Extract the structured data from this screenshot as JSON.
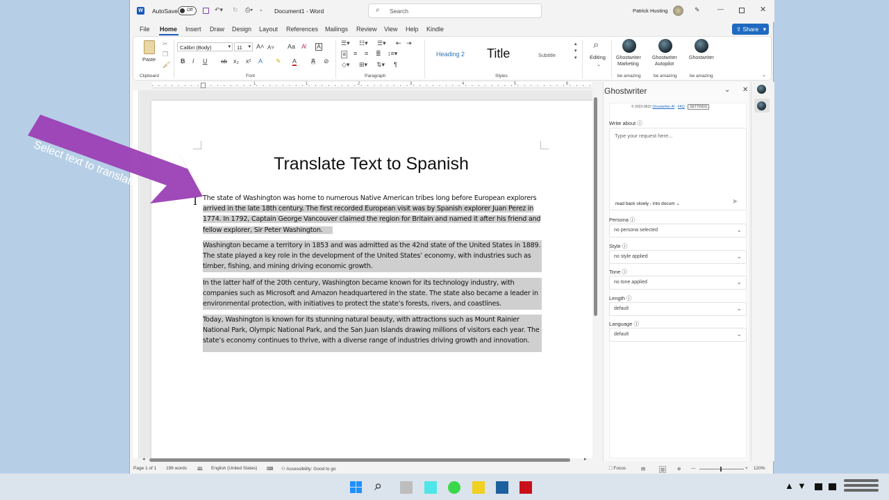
{
  "app": {
    "autosave_label": "AutoSave",
    "autosave_state": "Off",
    "document_name": "Document1 - Word",
    "search_placeholder": "Search",
    "user_name": "Patrick Husting"
  },
  "menu": {
    "tabs": [
      "File",
      "Home",
      "Insert",
      "Draw",
      "Design",
      "Layout",
      "References",
      "Mailings",
      "Review",
      "View",
      "Help",
      "Kindle"
    ],
    "share_label": "Share"
  },
  "ribbon": {
    "clipboard": {
      "paste_label": "Paste",
      "group_label": "Clipboard"
    },
    "font": {
      "font_name": "Calibri (Body)",
      "font_size": "11",
      "group_label": "Font"
    },
    "paragraph": {
      "group_label": "Paragraph"
    },
    "styles": {
      "heading2": "Heading 2",
      "title": "Title",
      "subtitle": "Subtitle",
      "group_label": "Styles"
    },
    "editing_label": "Editing",
    "addins": [
      {
        "name_line1": "Ghostwriter",
        "name_line2": "Marketing",
        "caption": "be amazing"
      },
      {
        "name_line1": "Ghostwriter",
        "name_line2": "Autopilot",
        "caption": "be amazing"
      },
      {
        "name_line1": "Ghostwriter",
        "name_line2": "",
        "caption": "be amazing"
      }
    ]
  },
  "ruler_numbers": [
    "1",
    "1",
    "2",
    "3",
    "4",
    "5",
    "6",
    "7"
  ],
  "document": {
    "title": "Translate Text to Spanish",
    "paragraphs": [
      [
        "The state of Washington was home to numerous Native American tribes long before European explorers",
        "arrived in the late 18th century. The first recorded European visit was by Spanish explorer Juan Perez in",
        "1774. In 1792, Captain George Vancouver claimed the region for Britain and named it after his friend and",
        "fellow explorer, Sir Peter Washington."
      ],
      [
        "Washington became a territory in 1853 and was admitted as the 42nd state of the United States in 1889.",
        "The state played a key role in the development of the United States’ economy, with industries such as",
        "timber, fishing, and mining driving economic growth."
      ],
      [
        "In the latter half of the 20th century, Washington became known for its technology industry, with",
        "companies such as Microsoft and Amazon headquartered in the state. The state also became a leader in",
        "environmental protection, with initiatives to protect the state’s forests, rivers, and coastlines."
      ],
      [
        "Today, Washington is known for its stunning natural beauty, with attractions such as Mount Rainier",
        "National Park, Olympic National Park, and the San Juan Islands drawing millions of visitors each year. The",
        "state’s economy continues to thrive, with a diverse range of industries driving growth and innovation."
      ]
    ]
  },
  "callout": {
    "text": "Select text to translate",
    "color": "#9b3fb5"
  },
  "ghostwriter": {
    "title": "Ghostwriter",
    "copyright_prefix": "© 2023-0622",
    "copyright_link": "Ghostwriter-AI",
    "faq_link": "FAQ",
    "settings_button": "SETTINGS",
    "write_about_label": "Write about",
    "request_placeholder": "Type your request here...",
    "read_back_option": "read back slowly - into docum",
    "fields": [
      {
        "label": "Persona",
        "value": "no persona selected"
      },
      {
        "label": "Style",
        "value": "no style applied"
      },
      {
        "label": "Tone",
        "value": "no tone applied"
      },
      {
        "label": "Length",
        "value": "default"
      },
      {
        "label": "Language",
        "value": "default"
      }
    ]
  },
  "status_bar": {
    "page": "Page 1 of 1",
    "words": "196 words",
    "language": "English (United States)",
    "accessibility": "Accessibility: Good to go",
    "focus": "Focus",
    "zoom": "120%"
  },
  "colors": {
    "accent": "#185abd",
    "selection": "#cfcfcf",
    "callout": "#9b3fb5"
  }
}
